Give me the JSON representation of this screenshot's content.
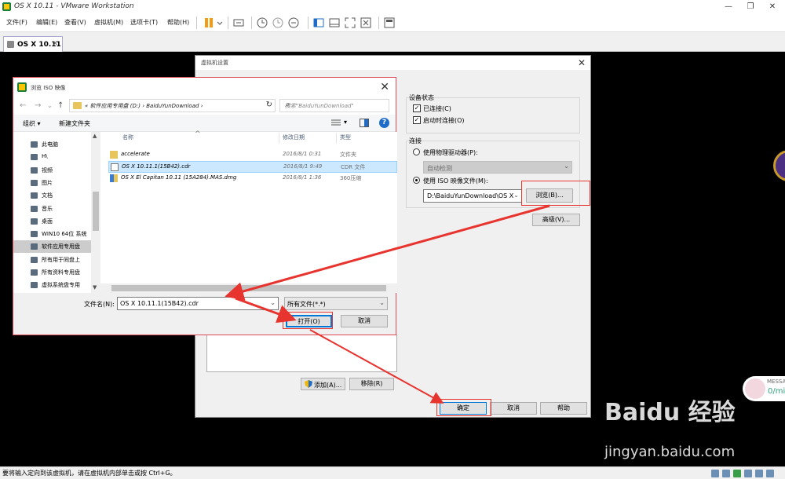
{
  "window": {
    "title": "OS X 10.11 - VMware Workstation"
  },
  "menu": [
    "文件(F)",
    "编辑(E)",
    "查看(V)",
    "虚拟机(M)",
    "选项卡(T)",
    "帮助(H)"
  ],
  "tab": {
    "label": "OS X 10.11"
  },
  "status_bar": {
    "text": "要将输入定向到该虚拟机，请在虚拟机内部单击或按 Ctrl+G。"
  },
  "message_widget": {
    "label": "MESSA",
    "value": "0/mi"
  },
  "watermark": {
    "brand": "Baidu 经验",
    "url": "jingyan.baidu.com"
  },
  "settings_dialog": {
    "title": "虚拟机设置",
    "device_status": {
      "heading": "设备状态",
      "connected": "已连接(C)",
      "connect_at_power_on": "启动时连接(O)"
    },
    "connection": {
      "heading": "连接",
      "use_physical": "使用物理驱动器(P):",
      "physical_value": "自动检测",
      "use_iso": "使用 ISO 映像文件(M):",
      "iso_path": "D:\\BaiduYunDownload\\OS X",
      "browse_button": "浏览(B)..."
    },
    "advanced_button": "高级(V)...",
    "add_button": "添加(A)...",
    "remove_button": "移除(R)",
    "ok_button": "确定",
    "cancel_button": "取消",
    "help_button": "帮助"
  },
  "browse_dialog": {
    "title": "浏览 ISO 映像",
    "address_path": "« 软件应用专用盘 (D:) › BaiduYunDownload ›",
    "search_placeholder": "搜索\"BaiduYunDownload\"",
    "organize": "组织 ▾",
    "new_folder": "新建文件夹",
    "nav_items": [
      {
        "label": "此电脑",
        "selected": false
      },
      {
        "label": "H\\",
        "selected": false
      },
      {
        "label": "视频",
        "selected": false
      },
      {
        "label": "图片",
        "selected": false
      },
      {
        "label": "文档",
        "selected": false
      },
      {
        "label": "音乐",
        "selected": false
      },
      {
        "label": "桌面",
        "selected": false
      },
      {
        "label": "WIN10 64位 系统",
        "selected": false
      },
      {
        "label": "软件应用专用盘",
        "selected": true
      },
      {
        "label": "所有用于同盘上",
        "selected": false
      },
      {
        "label": "所有资料专用盘",
        "selected": false
      },
      {
        "label": "虚拟系统盘专用",
        "selected": false
      }
    ],
    "columns": {
      "name": "名称",
      "date": "修改日期",
      "type": "类型"
    },
    "files": [
      {
        "name": "accelerate",
        "date": "2016/8/1 0:31",
        "type": "文件夹",
        "kind": "folder",
        "selected": false
      },
      {
        "name": "OS X 10.11.1(15B42).cdr",
        "date": "2016/8/1 9:49",
        "type": "CDR 文件",
        "kind": "file",
        "selected": true
      },
      {
        "name": "OS X El Capitan 10.11 (15A284).MAS.dmg",
        "date": "2016/8/1 1:36",
        "type": "360压缩",
        "kind": "archive",
        "selected": false
      }
    ],
    "filename_label": "文件名(N):",
    "filename_value": "OS X 10.11.1(15B42).cdr",
    "filter_value": "所有文件(*.*)",
    "open_button": "打开(O)",
    "cancel_button": "取消"
  },
  "colors": {
    "accent": "#0078d7",
    "annotation": "#e8342f",
    "selected_row": "#cce8ff"
  }
}
